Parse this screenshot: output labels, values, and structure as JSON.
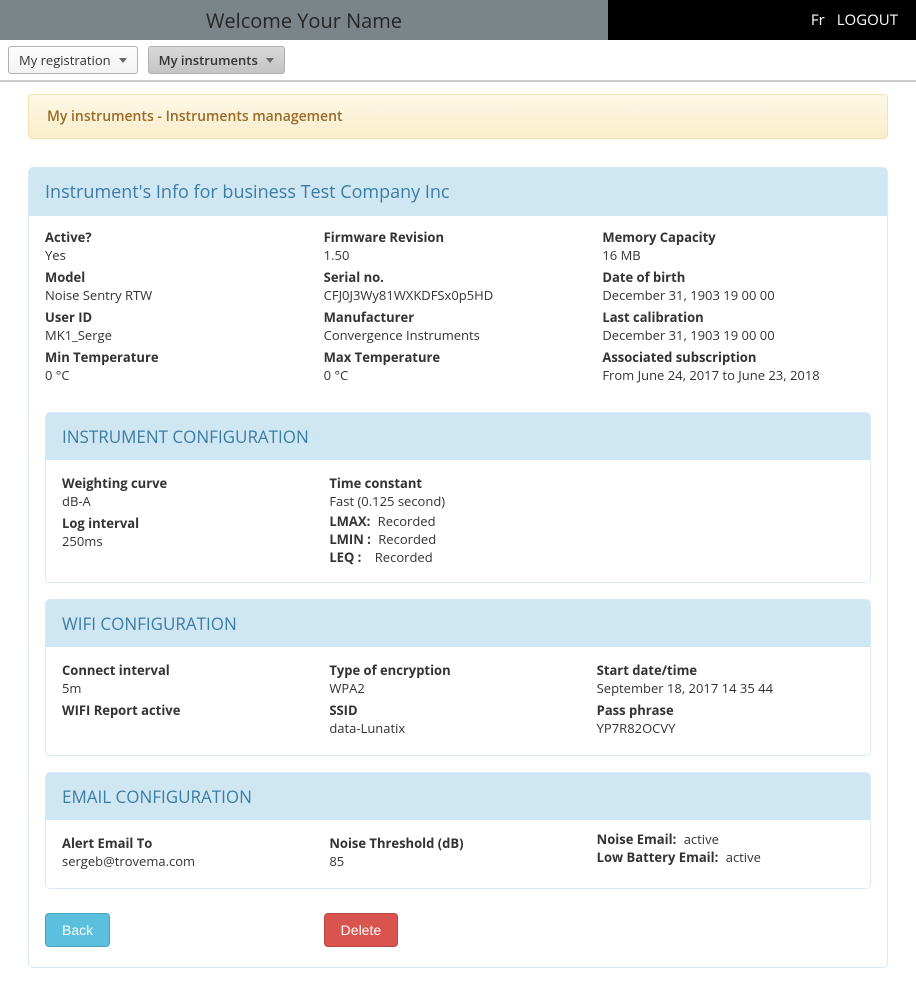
{
  "header": {
    "welcome": "Welcome  Your Name",
    "lang": "Fr",
    "logout": "LOGOUT"
  },
  "menu": {
    "my_registration": "My registration",
    "my_instruments": "My instruments"
  },
  "breadcrumb": "My instruments - Instruments management",
  "main_panel_title": "Instrument's Info for business Test Company Inc",
  "info": {
    "col1": {
      "active_label": "Active?",
      "active": "Yes",
      "model_label": "Model",
      "model": "Noise Sentry RTW",
      "user_id_label": "User ID",
      "user_id": "MK1_Serge",
      "min_temp_label": "Min Temperature",
      "min_temp": "0 °C"
    },
    "col2": {
      "firmware_label": "Firmware Revision",
      "firmware": "1.50",
      "serial_label": "Serial no.",
      "serial": "CFJ0J3Wy81WXKDFSx0p5HD",
      "manufacturer_label": "Manufacturer",
      "manufacturer": "Convergence Instruments",
      "max_temp_label": "Max Temperature",
      "max_temp": "0 °C"
    },
    "col3": {
      "memory_label": "Memory Capacity",
      "memory": "16 MB",
      "dob_label": "Date of birth",
      "dob": "December 31, 1903 19 00 00",
      "last_cal_label": "Last calibration",
      "last_cal": "December 31, 1903 19 00 00",
      "sub_label": "Associated subscription",
      "sub": "From June 24, 2017 to June 23, 2018"
    }
  },
  "instr_conf": {
    "title": "INSTRUMENT CONFIGURATION",
    "col1": {
      "weighting_label": "Weighting curve",
      "weighting": "dB-A",
      "log_interval_label": "Log interval",
      "log_interval": "250ms"
    },
    "col2": {
      "time_const_label": "Time constant",
      "time_const": "Fast (0.125 second)",
      "lmax_label": "LMAX:",
      "lmax": "Recorded",
      "lmin_label": "LMIN :",
      "lmin": "Recorded",
      "leq_label": "LEQ :",
      "leq": "Recorded"
    }
  },
  "wifi_conf": {
    "title": "WIFI CONFIGURATION",
    "col1": {
      "connect_label": "Connect interval",
      "connect": "5m",
      "report_label": "WIFI Report active"
    },
    "col2": {
      "enc_label": "Type of encryption",
      "enc": "WPA2",
      "ssid_label": "SSID",
      "ssid": "data-Lunatix"
    },
    "col3": {
      "start_label": "Start date/time",
      "start": "September 18, 2017 14 35 44",
      "pass_label": "Pass phrase",
      "pass": "YP7R82OCVY"
    }
  },
  "email_conf": {
    "title": "EMAIL CONFIGURATION",
    "col1": {
      "to_label": "Alert Email To",
      "to": "sergeb@trovema.com"
    },
    "col2": {
      "threshold_label": "Noise Threshold (dB)",
      "threshold": "85"
    },
    "col3": {
      "noise_email_label": "Noise Email:",
      "noise_email": "active",
      "low_batt_label": "Low Battery Email:",
      "low_batt": "active"
    }
  },
  "buttons": {
    "back": "Back",
    "delete": "Delete"
  }
}
